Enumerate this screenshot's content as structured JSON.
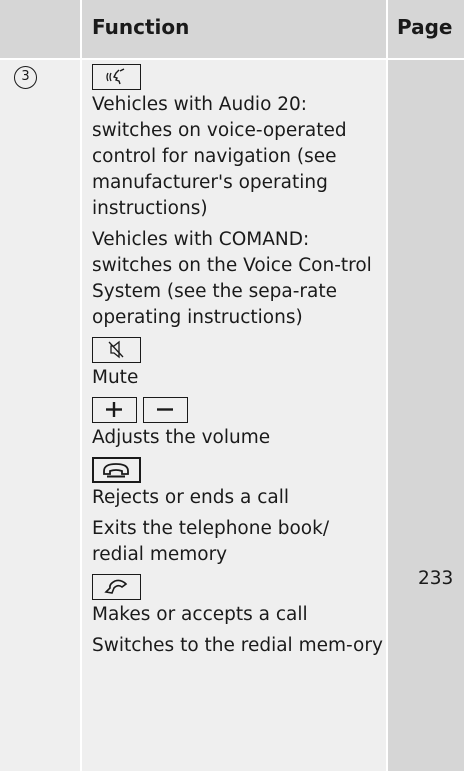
{
  "header": {
    "function_label": "Function",
    "page_label": "Page"
  },
  "row": {
    "number": "3",
    "keys": {
      "voice": "voice-control-key-icon",
      "mute": "mute-key-icon",
      "plus": "volume-up-key-icon",
      "minus": "volume-down-key-icon",
      "end": "end-call-key-icon",
      "accept": "accept-call-key-icon"
    },
    "voice_audio20": "Vehicles with Audio 20: switches on voice-operated control for navigation (see manufacturer's operating instructions)",
    "voice_comand": "Vehicles with COMAND: switches on the Voice Con-trol System (see the sepa-rate operating instructions)",
    "mute": "Mute",
    "volume": "Adjusts the volume",
    "reject_call": "Rejects or ends a call",
    "exit_phonebook": "Exits the telephone book/ redial memory",
    "accept_call": "Makes or accepts a call",
    "redial": "Switches to the redial mem-ory",
    "page": "233"
  },
  "colors": {
    "header_bg": "#d6d6d6",
    "cell_bg": "#efefef",
    "text": "#1a1a1a"
  }
}
